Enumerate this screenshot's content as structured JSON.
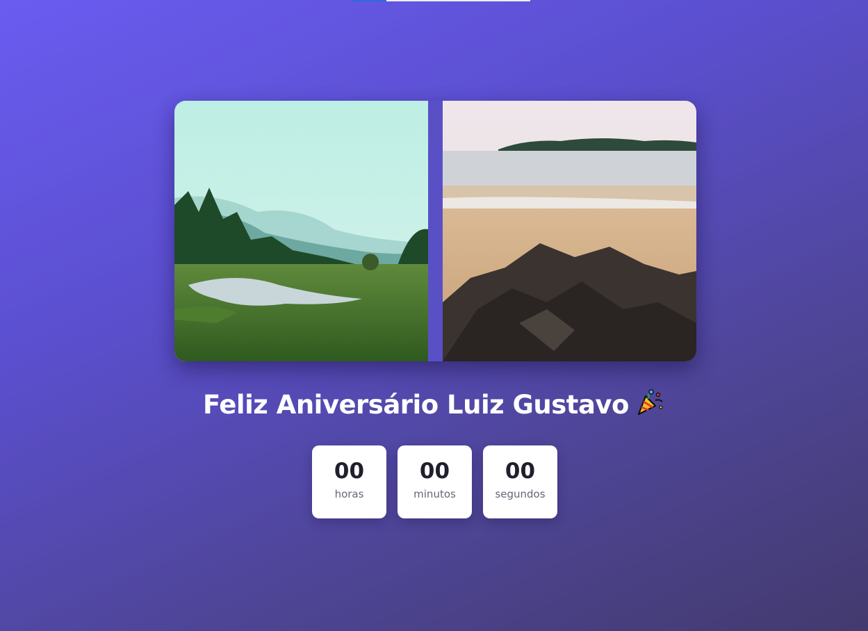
{
  "page": {
    "headline": "Feliz Aniversário Luiz Gustavo",
    "emoji": "🎉"
  },
  "gallery": {
    "photos": [
      {
        "name": "forest-river-photo"
      },
      {
        "name": "beach-rocks-photo"
      }
    ]
  },
  "countdown": [
    {
      "value": "00",
      "label": "horas"
    },
    {
      "value": "00",
      "label": "minutos"
    },
    {
      "value": "00",
      "label": "segundos"
    }
  ],
  "colors": {
    "background_start": "#6a5cf0",
    "background_end": "#433a6e",
    "card": "#ffffff",
    "number_text": "#1f1f2e",
    "label_text": "#666677"
  }
}
